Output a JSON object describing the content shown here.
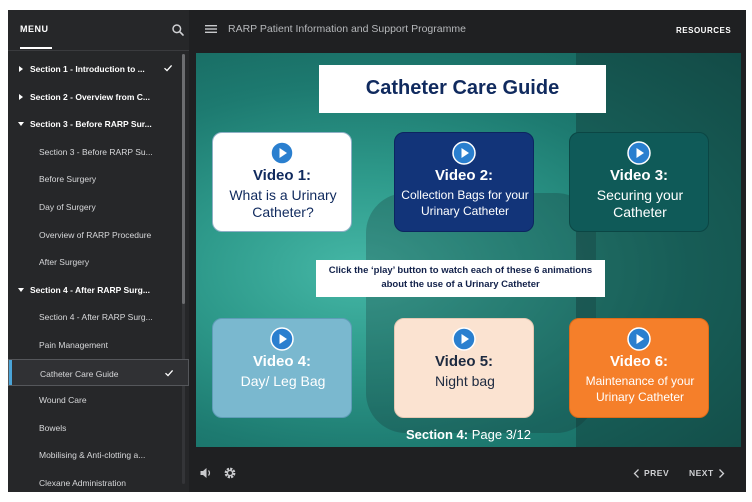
{
  "sidebar": {
    "title": "MENU",
    "items": [
      {
        "label": "Section 1 - Introduction to ...",
        "type": "section",
        "caret": "right",
        "checked": true
      },
      {
        "label": "Section 2 - Overview from C...",
        "type": "section",
        "caret": "right",
        "checked": false
      },
      {
        "label": "Section 3 - Before RARP Sur...",
        "type": "section",
        "caret": "down",
        "checked": false
      },
      {
        "label": "Section 3 - Before RARP Su...",
        "type": "sub",
        "checked": false
      },
      {
        "label": "Before Surgery",
        "type": "sub",
        "checked": false
      },
      {
        "label": "Day of Surgery",
        "type": "sub",
        "checked": false
      },
      {
        "label": "Overview of RARP Procedure",
        "type": "sub",
        "checked": false
      },
      {
        "label": "After Surgery",
        "type": "sub",
        "checked": false
      },
      {
        "label": "Section 4 - After RARP Surg...",
        "type": "section",
        "caret": "down",
        "checked": false
      },
      {
        "label": "Section 4 - After RARP Surg...",
        "type": "sub",
        "checked": false
      },
      {
        "label": "Pain Management",
        "type": "sub",
        "checked": false
      },
      {
        "label": "Catheter Care Guide",
        "type": "sub",
        "checked": true,
        "active": true
      },
      {
        "label": "Wound Care",
        "type": "sub",
        "checked": false
      },
      {
        "label": "Bowels",
        "type": "sub",
        "checked": false
      },
      {
        "label": "Mobilising & Anti-clotting a...",
        "type": "sub",
        "checked": false
      },
      {
        "label": "Clexane Administration",
        "type": "sub",
        "checked": false
      }
    ]
  },
  "header": {
    "title": "RARP Patient Information and Support Programme",
    "resources_label": "RESOURCES"
  },
  "slide": {
    "title": "Catheter Care Guide",
    "instructions": "Click the ‘play’ button to watch each of these 6 animations about the use of a Urinary Catheter",
    "videos": [
      {
        "title": "Video 1:",
        "subtitle": "What is a Urinary Catheter?"
      },
      {
        "title": "Video 2:",
        "subtitle": "Collection Bags for your Urinary Catheter"
      },
      {
        "title": "Video 3:",
        "subtitle": "Securing your Catheter"
      },
      {
        "title": "Video 4:",
        "subtitle": "Day/ Leg Bag"
      },
      {
        "title": "Video 5:",
        "subtitle": "Night bag"
      },
      {
        "title": "Video 6:",
        "subtitle": "Maintenance of your Urinary Catheter"
      }
    ],
    "page_section": "Section 4:",
    "page_number": "Page 3/12"
  },
  "footer": {
    "prev_label": "PREV",
    "next_label": "NEXT"
  },
  "colors": {
    "accent": "#4aa4d8",
    "title_navy": "#102a5e",
    "video2": "#123479",
    "video3": "#0f5a58",
    "video4": "#7ab8cf",
    "video5": "#fbe3d1",
    "video6": "#f57f2a"
  },
  "icons": [
    "search-icon",
    "hamburger-icon",
    "check-icon",
    "play-icon",
    "volume-icon",
    "gear-icon",
    "chevron-left-icon",
    "chevron-right-icon"
  ]
}
